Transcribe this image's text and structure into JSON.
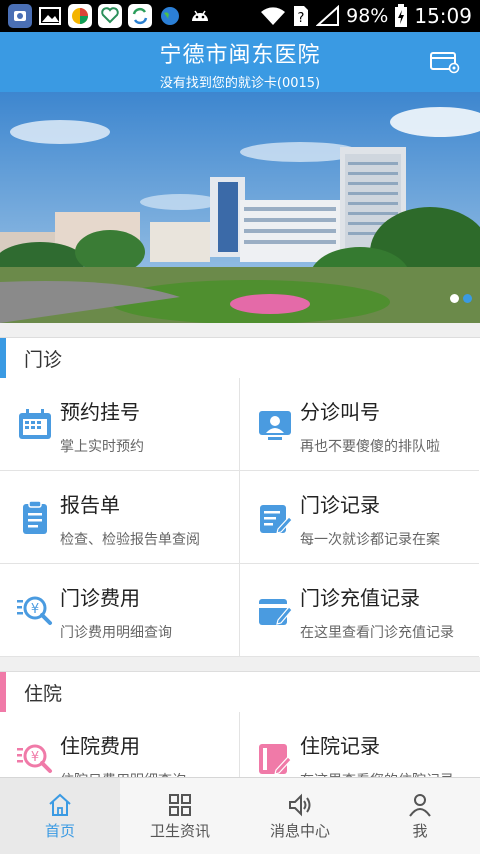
{
  "status_bar": {
    "battery": "98%",
    "time": "15:09",
    "icons": [
      "notification-app-icon",
      "gallery-icon",
      "app-icon",
      "health-app-icon",
      "sync-app-icon",
      "globe-app-icon",
      "android-icon",
      "wifi-icon",
      "no-sim-icon",
      "signal-icon",
      "battery-charging-icon"
    ]
  },
  "header": {
    "title": "宁德市闽东医院",
    "subtitle": "没有找到您的就诊卡(0015)",
    "card_icon": "card-settings-icon"
  },
  "banner": {
    "slides": 2,
    "active_slide": 2
  },
  "sections": [
    {
      "title": "门诊",
      "accent": "#3a9ae3",
      "items": [
        {
          "name": "预约挂号",
          "desc": "掌上实时预约",
          "icon": "calendar-icon"
        },
        {
          "name": "分诊叫号",
          "desc": "再也不要傻傻的排队啦",
          "icon": "queue-call-icon"
        },
        {
          "name": "报告单",
          "desc": "检查、检验报告单查阅",
          "icon": "clipboard-icon"
        },
        {
          "name": "门诊记录",
          "desc": "每一次就诊都记录在案",
          "icon": "record-edit-icon"
        },
        {
          "name": "门诊费用",
          "desc": "门诊费用明细查询",
          "icon": "fee-search-icon"
        },
        {
          "name": "门诊充值记录",
          "desc": "在这里查看门诊充值记录",
          "icon": "recharge-record-icon"
        }
      ]
    },
    {
      "title": "住院",
      "accent": "#f07aa8",
      "items": [
        {
          "name": "住院费用",
          "desc": "住院日费用明细查询",
          "icon": "fee-search-icon"
        },
        {
          "name": "住院记录",
          "desc": "在这里查看您的住院记录",
          "icon": "inpatient-record-icon"
        }
      ]
    }
  ],
  "bottom_nav": [
    {
      "label": "首页",
      "icon": "home-icon",
      "active": true
    },
    {
      "label": "卫生资讯",
      "icon": "grid-icon",
      "active": false
    },
    {
      "label": "消息中心",
      "icon": "speaker-icon",
      "active": false
    },
    {
      "label": "我",
      "icon": "person-icon",
      "active": false
    }
  ],
  "colors": {
    "primary": "#3a9ae3",
    "inpatient_accent": "#f07aa8",
    "icon_blue": "#4a9be0"
  }
}
